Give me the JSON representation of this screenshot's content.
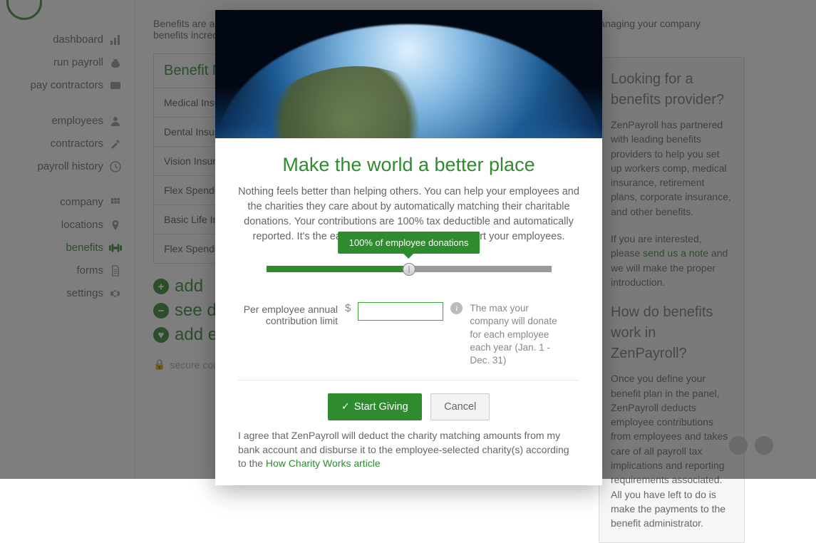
{
  "sidebar": {
    "items": [
      {
        "label": "dashboard"
      },
      {
        "label": "run payroll"
      },
      {
        "label": "pay contractors"
      },
      {
        "label": "employees"
      },
      {
        "label": "contractors"
      },
      {
        "label": "payroll history"
      },
      {
        "label": "company"
      },
      {
        "label": "locations"
      },
      {
        "label": "benefits"
      },
      {
        "label": "forms"
      },
      {
        "label": "settings"
      }
    ]
  },
  "main": {
    "intro": "Benefits are a great way to support your employees and encourage productivity. ZenPayroll makes managing your company benefits incredibly simple.",
    "table_header": "Benefit Name",
    "rows": [
      "Medical Insurance",
      "Dental Insurance",
      "Vision Insurance",
      "Flex Spending",
      "Basic Life Insurance",
      "Flex Spending"
    ],
    "add_label": "add",
    "see_label": "see details",
    "add_e_label": "add employee",
    "secure_label": "secure connection"
  },
  "info": {
    "h1": "Looking for a benefits provider?",
    "p1": "ZenPayroll has partnered with leading benefits providers to help you set up workers comp, medical insurance, retirement plans, corporate insurance, and other benefits.",
    "p1b": "If you are interested, please ",
    "link1": "send us a note",
    "p1c": " and we will make the proper introduction.",
    "h2": "How do benefits work in ZenPayroll?",
    "p2": "Once you define your benefit plan in the panel, ZenPayroll deducts employee contributions from employees and takes care of all payroll tax implications and reporting requirements associated. All you have left to do is make the payments to the benefit administrator."
  },
  "modal": {
    "title": "Make the world a better place",
    "body": "Nothing feels better than helping others. You can help your employees and the charities they care about by automatically matching their charitable donations. Your contributions are 100% tax deductible and automatically reported. It's the easiest way to give and to support your employees.",
    "tooltip": "100% of employee donations",
    "limit_label": "Per employee annual contribution limit",
    "dollar": "$",
    "input_value": "",
    "help": "The max your company will donate for each employee each year (Jan. 1 - Dec. 31)",
    "start_label": "Start Giving",
    "cancel_label": "Cancel",
    "agree_a": "I agree that ZenPayroll will deduct the charity matching amounts from my bank account and disburse it to the employee-selected charity(s) according to the ",
    "agree_link": "How Charity Works article"
  }
}
